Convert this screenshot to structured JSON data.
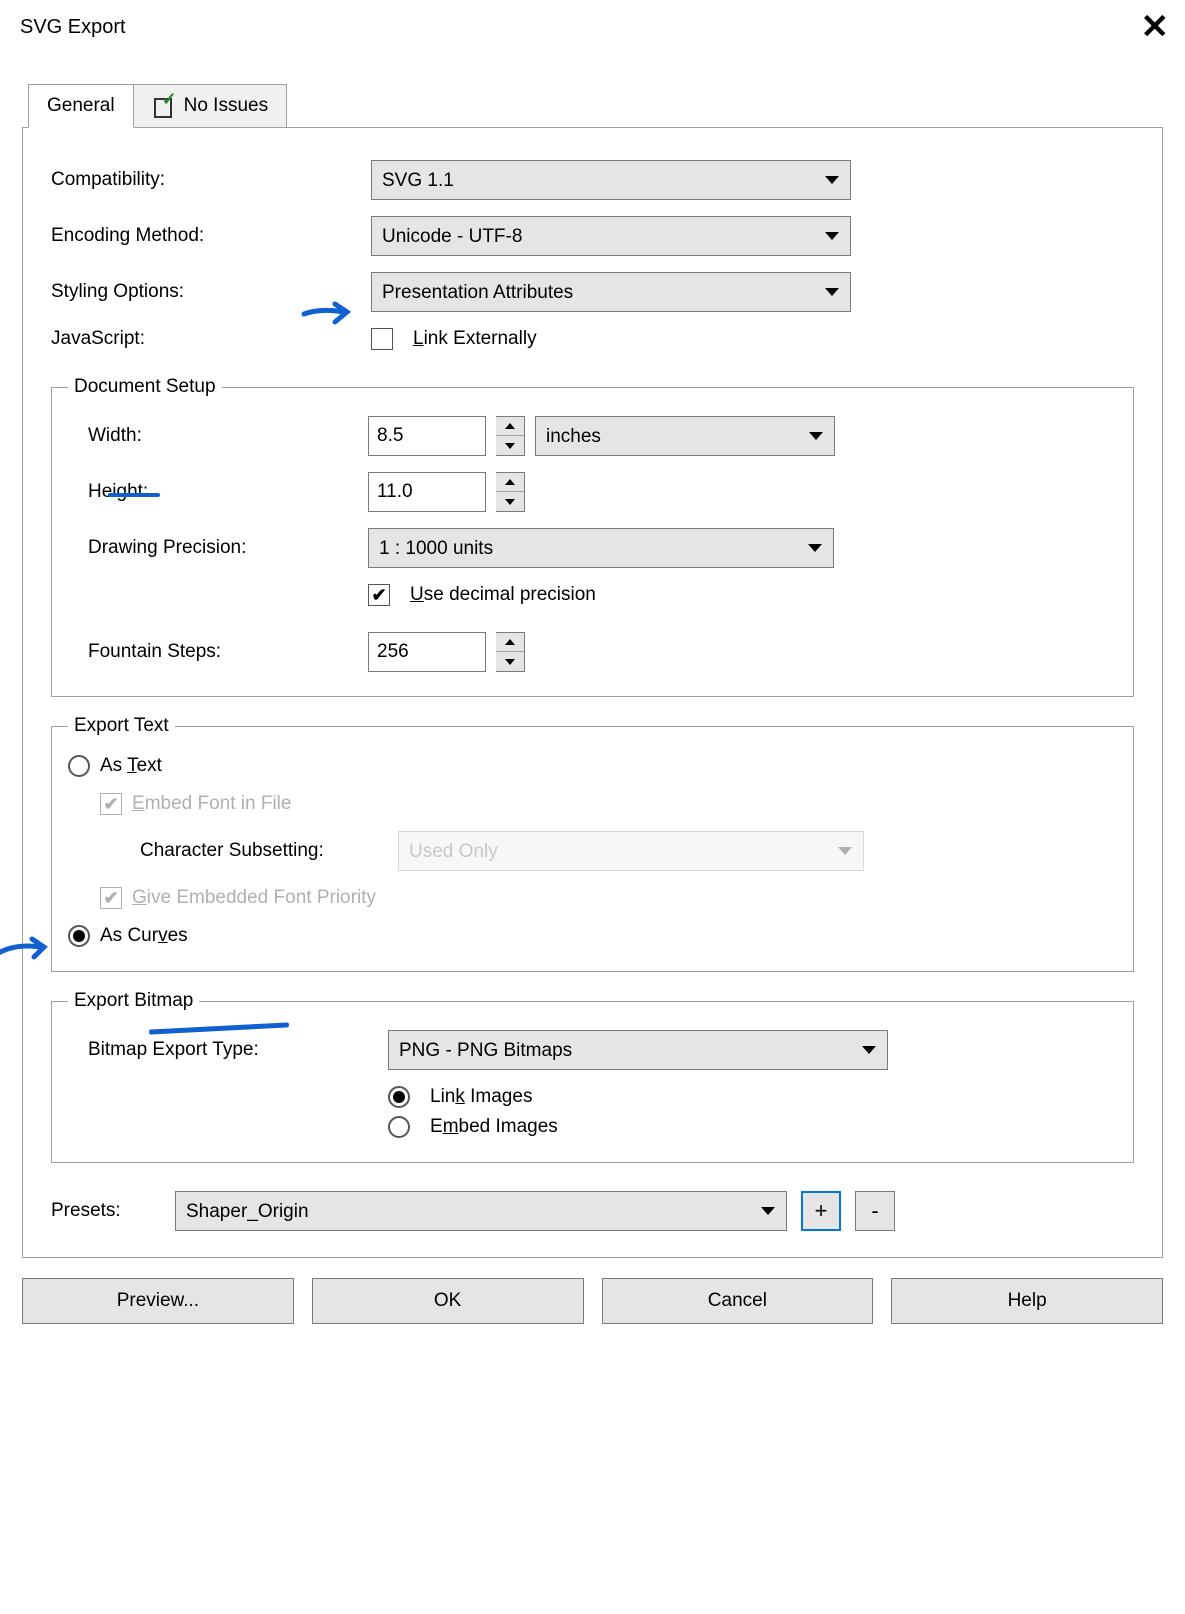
{
  "dialog": {
    "title": "SVG Export"
  },
  "tabs": {
    "general": "General",
    "issues": "No Issues"
  },
  "labels": {
    "compatibility": "Compatibility:",
    "encoding": "Encoding Method:",
    "styling": "Styling Options:",
    "javascript": "JavaScript:",
    "linkExternally": "Link Externally",
    "docSetup": "Document Setup",
    "width": "Width:",
    "height": "Height:",
    "drawingPrecision": "Drawing Precision:",
    "useDecimal": "Use decimal precision",
    "fountainSteps": "Fountain Steps:",
    "exportText": "Export Text",
    "asText": "As Text",
    "embedFont": "Embed Font in File",
    "charSubsetting": "Character Subsetting:",
    "givePriority": "Give Embedded Font Priority",
    "asCurves": "As Curves",
    "exportBitmap": "Export Bitmap",
    "bitmapType": "Bitmap Export Type:",
    "linkImages": "Link Images",
    "embedImages": "Embed Images",
    "presets": "Presets:"
  },
  "values": {
    "compatibility": "SVG 1.1",
    "encoding": "Unicode - UTF-8",
    "styling": "Presentation Attributes",
    "width": "8.5",
    "widthUnit": "inches",
    "height": "11.0",
    "drawingPrecision": "1 : 1000 units",
    "fountainSteps": "256",
    "charSubsetting": "Used Only",
    "bitmapType": "PNG - PNG Bitmaps",
    "preset": "Shaper_Origin"
  },
  "buttons": {
    "add": "+",
    "remove": "-",
    "preview": "Preview...",
    "ok": "OK",
    "cancel": "Cancel",
    "help": "Help"
  }
}
